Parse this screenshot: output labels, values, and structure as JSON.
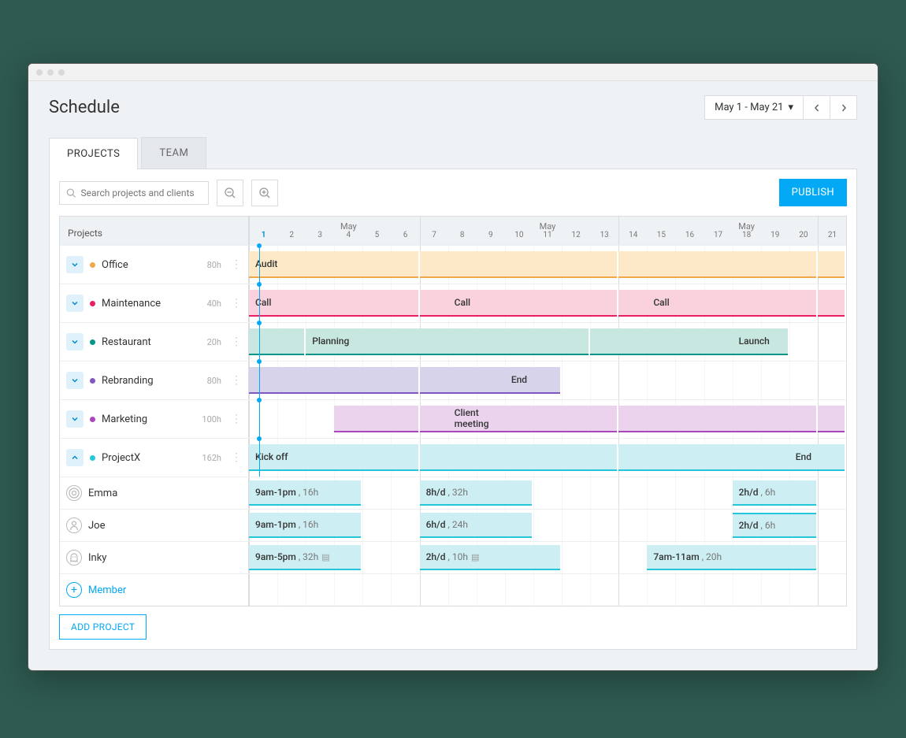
{
  "page_title": "Schedule",
  "date_range": "May 1 - May 21",
  "tabs": {
    "projects": "PROJECTS",
    "team": "TEAM"
  },
  "search_placeholder": "Search projects and clients",
  "publish_label": "PUBLISH",
  "header_label": "Projects",
  "month_label": "May",
  "days": [
    "1",
    "2",
    "3",
    "4",
    "5",
    "6",
    "7",
    "8",
    "9",
    "10",
    "11",
    "12",
    "13",
    "14",
    "15",
    "16",
    "17",
    "18",
    "19",
    "20",
    "21"
  ],
  "projects": [
    {
      "name": "Office",
      "hours": "80h",
      "color": "#f0a84a",
      "bars": [
        {
          "label": "Audit",
          "start": 1,
          "end": 5,
          "milestone": true
        },
        {
          "start": 1,
          "end": 6
        },
        {
          "start": 7,
          "end": 13
        },
        {
          "start": 14,
          "end": 20
        },
        {
          "start": 21,
          "end": 21
        }
      ]
    },
    {
      "name": "Maintenance",
      "hours": "40h",
      "color": "#e91e63",
      "bars": [
        {
          "label": "Call",
          "start": 1,
          "end": 2,
          "milestone": true
        },
        {
          "label": "Call",
          "start": 8,
          "end": 9,
          "milestone": true
        },
        {
          "label": "Call",
          "start": 15,
          "end": 16,
          "milestone": true
        },
        {
          "start": 1,
          "end": 6
        },
        {
          "start": 7,
          "end": 13
        },
        {
          "start": 14,
          "end": 20
        },
        {
          "start": 21,
          "end": 21
        }
      ]
    },
    {
      "name": "Restaurant",
      "hours": "20h",
      "color": "#009688",
      "bars": [
        {
          "start": 1,
          "end": 2
        },
        {
          "label": "Planning",
          "start": 3,
          "end": 5,
          "milestone": true
        },
        {
          "start": 3,
          "end": 12
        },
        {
          "start": 13,
          "end": 18
        },
        {
          "label": "Launch",
          "start": 18,
          "end": 19,
          "milestone": true
        }
      ]
    },
    {
      "name": "Rebranding",
      "hours": "80h",
      "color": "#7e57c2",
      "bars": [
        {
          "start": 1,
          "end": 6
        },
        {
          "start": 7,
          "end": 10
        },
        {
          "label": "End",
          "start": 10,
          "end": 11,
          "milestone": true
        }
      ]
    },
    {
      "name": "Marketing",
      "hours": "100h",
      "color": "#ab47bc",
      "bars": [
        {
          "start": 4,
          "end": 6
        },
        {
          "label": "Client meeting",
          "start": 8,
          "end": 9,
          "milestone": true
        },
        {
          "start": 7,
          "end": 13
        },
        {
          "start": 14,
          "end": 20
        },
        {
          "start": 21,
          "end": 21
        }
      ]
    },
    {
      "name": "ProjectX",
      "hours": "162h",
      "color": "#26c6da",
      "expanded": true,
      "bars": [
        {
          "label": "Kick off",
          "start": 1,
          "end": 3,
          "milestone": true
        },
        {
          "start": 1,
          "end": 6
        },
        {
          "start": 7,
          "end": 13
        },
        {
          "start": 14,
          "end": 20
        },
        {
          "label": "End",
          "start": 20,
          "end": 21,
          "milestone": true
        }
      ],
      "members": [
        {
          "name": "Emma",
          "icon": "ring",
          "bars": [
            {
              "label": "9am-1pm",
              "sub": ", 16h",
              "start": 1,
              "end": 4
            },
            {
              "label": "8h/d",
              "sub": ", 32h",
              "start": 7,
              "end": 10
            },
            {
              "label": "2h/d",
              "sub": ", 6h",
              "start": 18,
              "end": 20
            }
          ]
        },
        {
          "name": "Joe",
          "icon": "person",
          "bars": [
            {
              "label": "9am-1pm",
              "sub": ", 16h",
              "start": 1,
              "end": 4
            },
            {
              "label": "6h/d",
              "sub": ", 24h",
              "start": 7,
              "end": 10
            },
            {
              "label": "2h/d",
              "sub": ", 6h",
              "start": 18,
              "end": 20,
              "redtop": true
            }
          ]
        },
        {
          "name": "Inky",
          "icon": "ghost",
          "bars": [
            {
              "label": "9am-5pm",
              "sub": ", 32h",
              "start": 1,
              "end": 4,
              "note": true
            },
            {
              "label": "2h/d",
              "sub": ", 10h",
              "start": 7,
              "end": 11,
              "note": true
            },
            {
              "label": "7am-11am",
              "sub": ", 20h",
              "start": 15,
              "end": 20
            }
          ]
        }
      ]
    }
  ],
  "add_member_label": "Member",
  "add_project_label": "ADD PROJECT",
  "colors": {
    "Office_bg": "#fde9c7",
    "Office_bd": "#f0a84a",
    "Maintenance_bg": "#fad2dd",
    "Maintenance_bd": "#e91e63",
    "Restaurant_bg": "#c9e7e1",
    "Restaurant_bd": "#009688",
    "Rebranding_bg": "#d6d3ea",
    "Rebranding_bd": "#7e57c2",
    "Marketing_bg": "#ecd3ed",
    "Marketing_bd": "#ab47bc",
    "ProjectX_bg": "#cdeef2",
    "ProjectX_bd": "#26c6da"
  }
}
